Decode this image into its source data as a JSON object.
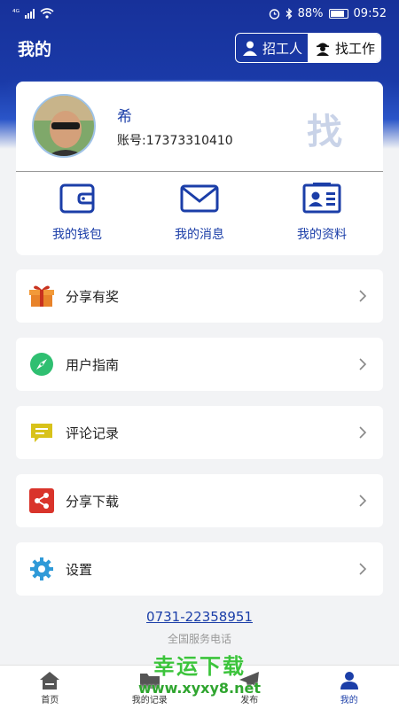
{
  "status_bar": {
    "network": "⁴ᴳ",
    "battery_percent": "88%",
    "time": "09:52"
  },
  "header": {
    "title": "我的",
    "recruit_label": "招工人",
    "find_job_label": "找工作"
  },
  "profile": {
    "name": "希",
    "account": "账号:17373310410",
    "watermark_char": "找"
  },
  "quick_actions": [
    {
      "label": "我的钱包",
      "icon": "wallet-icon"
    },
    {
      "label": "我的消息",
      "icon": "mail-icon"
    },
    {
      "label": "我的资料",
      "icon": "id-card-icon"
    }
  ],
  "menu": [
    {
      "label": "分享有奖",
      "icon": "gift-icon"
    },
    {
      "label": "用户指南",
      "icon": "compass-icon"
    },
    {
      "label": "评论记录",
      "icon": "comment-icon"
    },
    {
      "label": "分享下载",
      "icon": "share-icon"
    },
    {
      "label": "设置",
      "icon": "gear-icon"
    }
  ],
  "service": {
    "phone": "0731-22358951",
    "caption": "全国服务电话"
  },
  "tabbar": [
    {
      "label": "首页",
      "icon": "home-icon"
    },
    {
      "label": "我的记录",
      "icon": "folder-icon"
    },
    {
      "label": "发布",
      "icon": "send-icon"
    },
    {
      "label": "我的",
      "icon": "user-icon",
      "active": true
    }
  ],
  "watermark": {
    "cn": "幸运下载",
    "url": "www.xyxy8.net"
  },
  "colors": {
    "brand_blue": "#1b3ea8",
    "header_blue": "#17319a",
    "gift_orange": "#e8832a",
    "compass_green": "#2fbf71",
    "comment_yellow": "#d8c21a",
    "share_red": "#d9342b",
    "gear_blue": "#2f9ad8"
  }
}
